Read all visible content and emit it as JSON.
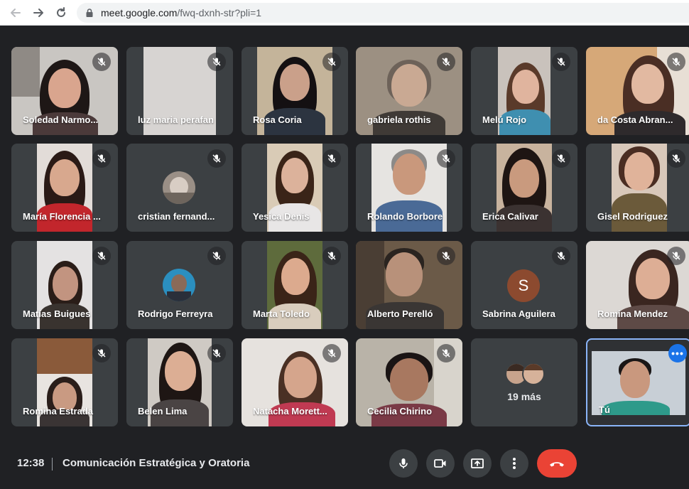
{
  "browser": {
    "url_domain": "meet.google.com",
    "url_path": "/fwq-dxnh-str?pli=1"
  },
  "participants": [
    {
      "name": "Soledad Narmo..."
    },
    {
      "name": "luz maria perafan"
    },
    {
      "name": "Rosa Coria"
    },
    {
      "name": "gabriela rothis"
    },
    {
      "name": "Melú Rojo"
    },
    {
      "name": "da Costa Abran..."
    },
    {
      "name": "María Florencia ..."
    },
    {
      "name": "cristian fernand..."
    },
    {
      "name": "Yesica Denis"
    },
    {
      "name": "Rolando Borbore"
    },
    {
      "name": "Erica Calivar"
    },
    {
      "name": "Gisel Rodriguez"
    },
    {
      "name": "Matías Buigues"
    },
    {
      "name": "Rodrigo Ferreyra"
    },
    {
      "name": "Marta Toledo"
    },
    {
      "name": "Alberto Perelló"
    },
    {
      "name": "Sabrina Aguilera",
      "initial": "S"
    },
    {
      "name": "Romina Mendez"
    },
    {
      "name": "Romina Estrada"
    },
    {
      "name": "Belen Lima"
    },
    {
      "name": "Natacha Morett..."
    },
    {
      "name": "Cecilia Chirino"
    }
  ],
  "more_tile": {
    "label": "19 más"
  },
  "self_tile": {
    "name": "Tú",
    "options_label": "•••"
  },
  "footer": {
    "time": "12:38",
    "meeting_title": "Comunicación Estratégica y Oratoria"
  },
  "colors": {
    "background": "#202124",
    "tile": "#3c4043",
    "hangup": "#ea4335",
    "accent": "#1a73e8"
  }
}
